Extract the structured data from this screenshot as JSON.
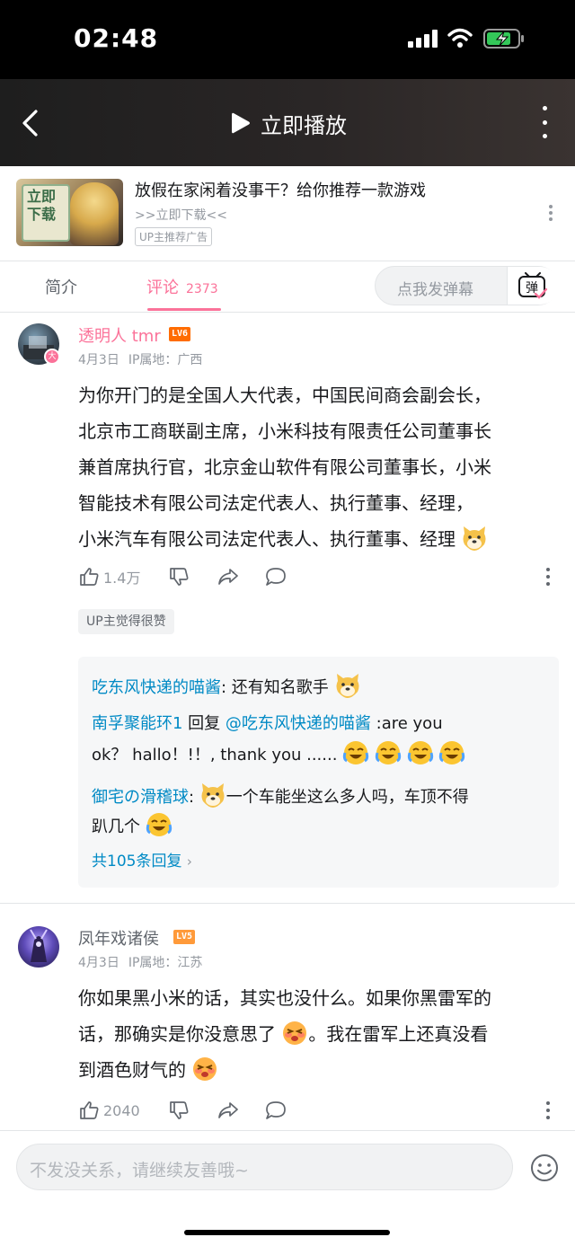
{
  "status_bar": {
    "time": "02:48",
    "battery_icon": "battery-charging-icon",
    "signal_icon": "cell-signal-icon",
    "wifi_icon": "wifi-icon"
  },
  "video_bar": {
    "back_icon": "chevron-left-icon",
    "play_icon": "play-icon",
    "play_label": "立即播放",
    "more_icon": "more-vertical-icon"
  },
  "ad": {
    "thumb_text_1": "立即",
    "thumb_text_2": "下载",
    "title": "放假在家闲着没事干？给你推荐一款游戏",
    "link": ">>立即下载<<",
    "tag": "UP主推荐广告"
  },
  "tabs": {
    "intro": "简介",
    "comments": "评论",
    "comment_count": "2373"
  },
  "danmaku": {
    "placeholder": "点我发弹幕",
    "button_glyph": "弹"
  },
  "comments": [
    {
      "user": "透明人 tmr",
      "level": "LV6",
      "badge": "大",
      "date": "4月3日",
      "location": "IP属地：广西",
      "lines": [
        "为你开门的是全国人大代表，中国民间商会副会长，",
        "北京市工商联副主席，小米科技有限责任公司董事长",
        "兼首席执行官，北京金山软件有限公司董事长，小米",
        "智能技术有限公司法定代表人、执行董事、经理，",
        "小米汽车有限公司法定代表人、执行董事、经理"
      ],
      "likes": "1.4万",
      "up_liked": "UP主觉得很赞",
      "replies": [
        {
          "user": "吃东风快递的喵酱",
          "sep": ": ",
          "text": "还有知名歌手"
        },
        {
          "user": "南孚聚能环1",
          "mid": " 回复 ",
          "mention": "@吃东风快递的喵酱",
          "text": " :are you",
          "text2": "ok？ hallo！!！, thank you ......"
        },
        {
          "user": "御宅の滑稽球",
          "sep": ": ",
          "text": "一个车能坐这么多人吗，车顶不得",
          "text2": "趴几个"
        }
      ],
      "reply_total": "共105条回复"
    },
    {
      "user": "凤年戏诸侯",
      "level": "LV5",
      "date": "4月3日",
      "location": "IP属地：江苏",
      "lines": [
        "你如果黑小米的话，其实也没什么。如果你黑雷军的",
        "话，那确实是你没意思了",
        "到酒色财气的"
      ],
      "line2_tail": "。我在雷军上还真没看",
      "likes": "2040"
    }
  ],
  "bottom": {
    "placeholder": "不发没关系，请继续友善哦~",
    "emoji_icon": "smiley-face-icon"
  },
  "colors": {
    "accent_pink": "#fb7299",
    "link_blue": "#008ac5",
    "level6": "#ff6c00",
    "level5": "#ff9a3a"
  }
}
